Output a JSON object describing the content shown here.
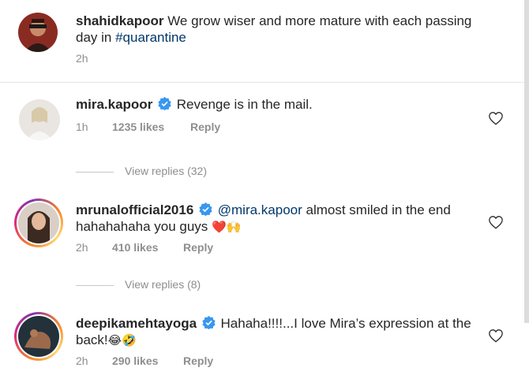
{
  "caption": {
    "username": "shahidkapoor",
    "text": " We grow wiser and more mature with each passing day in ",
    "hashtag": "#quarantine",
    "time": "2h"
  },
  "comments": [
    {
      "username": "mira.kapoor",
      "text_before": "Revenge is in the mail.",
      "time": "1h",
      "likes": "1235 likes",
      "reply": "Reply",
      "view_replies": "View replies (32)",
      "verified": true
    },
    {
      "username": "mrunalofficial2016",
      "mention": "@mira.kapoor",
      "text_before": " almost smiled in the end",
      "text_line2": "hahahahaha  you guys ",
      "emojis": "❤️🙌",
      "time": "2h",
      "likes": "410 likes",
      "reply": "Reply",
      "view_replies": "View replies (8)",
      "verified": true
    },
    {
      "username": "deepikamehtayoga",
      "text_before": "Hahaha!!!!...I love Mira’s expression at the",
      "text_line2": "back!",
      "emojis": "😂🤣",
      "time": "2h",
      "likes": "290 likes",
      "reply": "Reply",
      "verified": true
    }
  ],
  "icons": {
    "verified": "verified-badge-icon",
    "heart": "heart-outline-icon"
  },
  "colors": {
    "link": "#00376b",
    "verified": "#3897f0",
    "meta": "#8e8e8e"
  }
}
